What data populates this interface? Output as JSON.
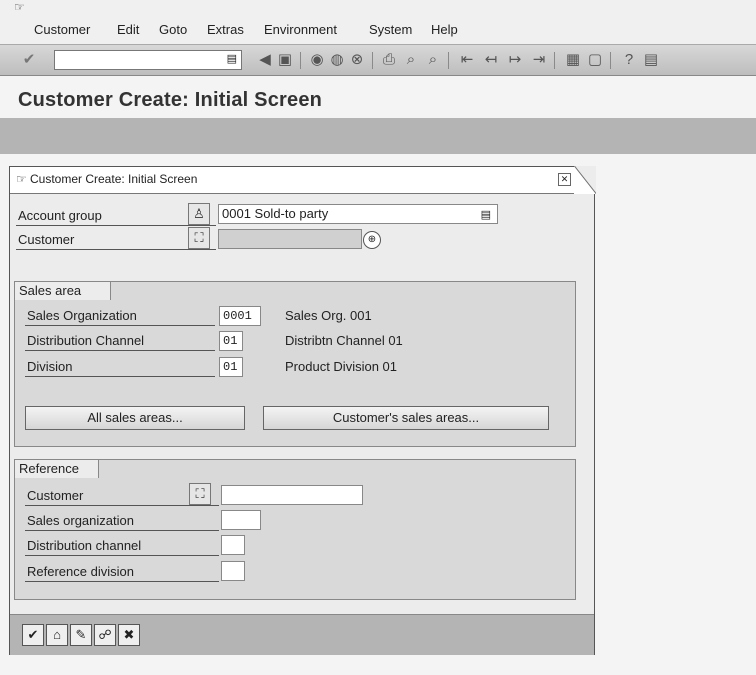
{
  "menubar": {
    "items": [
      "Customer",
      "Edit",
      "Goto",
      "Extras",
      "Environment",
      "System",
      "Help"
    ]
  },
  "toolbar": {
    "command_field_value": "",
    "icons": [
      "enter-icon",
      "command-dropdown-icon",
      "back-arrow-icon",
      "save-icon",
      "back-icon",
      "exit-icon",
      "cancel-icon",
      "print-icon",
      "find-icon",
      "find-next-icon",
      "first-page-icon",
      "previous-page-icon",
      "next-page-icon",
      "last-page-icon",
      "create-session-icon",
      "shortcut-icon",
      "help-icon",
      "layout-icon"
    ]
  },
  "page": {
    "title": "Customer Create: Initial Screen"
  },
  "dialog": {
    "title": "Customer Create: Initial Screen",
    "account_group": {
      "label": "Account group",
      "value": "0001 Sold-to party"
    },
    "customer": {
      "label": "Customer",
      "value": ""
    },
    "sales_area": {
      "heading": "Sales area",
      "sales_org": {
        "label": "Sales Organization",
        "value": "0001",
        "desc": "Sales Org. 001"
      },
      "dist_channel": {
        "label": "Distribution Channel",
        "value": "01",
        "desc": "Distribtn Channel 01"
      },
      "division": {
        "label": "Division",
        "value": "01",
        "desc": "Product Division 01"
      },
      "all_sales_areas_button": "All sales areas...",
      "customers_sales_areas_button": "Customer's sales areas..."
    },
    "reference": {
      "heading": "Reference",
      "customer": {
        "label": "Customer",
        "value": ""
      },
      "sales_org": {
        "label": "Sales organization",
        "value": ""
      },
      "dist_channel": {
        "label": "Distribution channel",
        "value": ""
      },
      "ref_division": {
        "label": "Reference division",
        "value": ""
      }
    },
    "bottom_buttons": [
      "continue-icon",
      "organizational-levels-icon",
      "edit-icon",
      "link-icon",
      "cancel-icon"
    ]
  }
}
